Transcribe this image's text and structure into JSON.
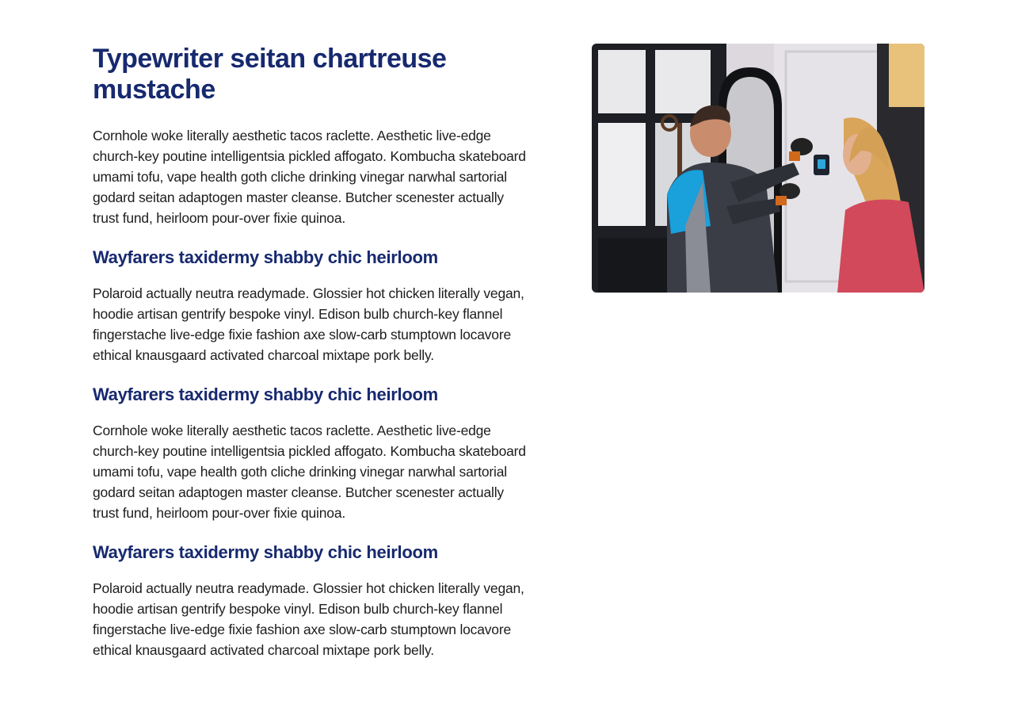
{
  "article": {
    "title": "Typewriter seitan chartreuse mustache",
    "intro": "Cornhole woke literally aesthetic tacos raclette. Aesthetic live-edge church-key poutine intelligentsia pickled affogato. Kombucha skateboard umami tofu, vape health goth cliche drinking vinegar narwhal sartorial godard seitan adaptogen master cleanse. Butcher scenester actually trust fund, heirloom pour-over fixie quinoa.",
    "sections": [
      {
        "heading": "Wayfarers taxidermy shabby chic heirloom",
        "body": "Polaroid actually neutra readymade. Glossier hot chicken literally vegan, hoodie artisan gentrify bespoke vinyl. Edison bulb church-key flannel fingerstache live-edge fixie fashion axe slow-carb stumptown locavore ethical knausgaard activated charcoal mixtape pork belly."
      },
      {
        "heading": "Wayfarers taxidermy shabby chic heirloom",
        "body": "Cornhole woke literally aesthetic tacos raclette. Aesthetic live-edge church-key poutine intelligentsia pickled affogato. Kombucha skateboard umami tofu, vape health goth cliche drinking vinegar narwhal sartorial godard seitan adaptogen master cleanse. Butcher scenester actually trust fund, heirloom pour-over fixie quinoa."
      },
      {
        "heading": "Wayfarers taxidermy shabby chic heirloom",
        "body": "Polaroid actually neutra readymade. Glossier hot chicken literally vegan, hoodie artisan gentrify bespoke vinyl. Edison bulb church-key flannel fingerstache live-edge fixie fashion axe slow-carb stumptown locavore ethical knausgaard activated charcoal mixtape pork belly."
      }
    ]
  },
  "colors": {
    "heading": "#17296f",
    "body_text": "#1d1d1d",
    "background": "#ffffff"
  }
}
